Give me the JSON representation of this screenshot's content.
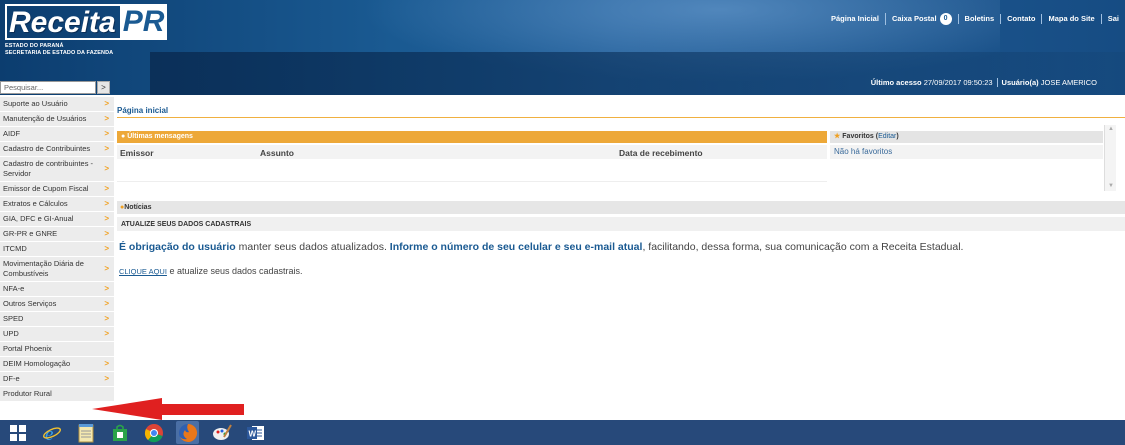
{
  "header": {
    "logo": {
      "main": "Receita",
      "accent": "PR",
      "line1": "ESTADO DO PARANÁ",
      "line2": "SECRETARIA DE ESTADO DA FAZENDA"
    },
    "topnav": {
      "home": "Página Inicial",
      "mailbox": "Caixa Postal",
      "mailbox_count": "0",
      "bulletins": "Boletins",
      "contact": "Contato",
      "sitemap": "Mapa do Site",
      "exit": "Sai"
    },
    "access": {
      "last_access_label": "Último acesso",
      "last_access_value": "27/09/2017 09:50:23",
      "user_label": "Usuário(a)",
      "user_value": "JOSE AMERICO"
    }
  },
  "sidebar": {
    "search_placeholder": "Pesquisar...",
    "search_button": ">",
    "items": [
      {
        "label": "Suporte ao Usuário",
        "arrow": ">"
      },
      {
        "label": "Manutenção de Usuários",
        "arrow": ">"
      },
      {
        "label": "AIDF",
        "arrow": ">"
      },
      {
        "label": "Cadastro de Contribuintes",
        "arrow": ">"
      },
      {
        "label": "Cadastro de contribuintes - Servidor",
        "arrow": ">"
      },
      {
        "label": "Emissor de Cupom Fiscal",
        "arrow": ">"
      },
      {
        "label": "Extratos e Cálculos",
        "arrow": ">"
      },
      {
        "label": "GIA, DFC e GI-Anual",
        "arrow": ">"
      },
      {
        "label": "GR-PR e GNRE",
        "arrow": ">"
      },
      {
        "label": "ITCMD",
        "arrow": ">"
      },
      {
        "label": "Movimentação Diária de Combustíveis",
        "arrow": ">"
      },
      {
        "label": "NFA-e",
        "arrow": ">"
      },
      {
        "label": "Outros Serviços",
        "arrow": ">"
      },
      {
        "label": "SPED",
        "arrow": ">"
      },
      {
        "label": "UPD",
        "arrow": ">"
      },
      {
        "label": "Portal Phoenix",
        "arrow": ""
      },
      {
        "label": "DEIM Homologação",
        "arrow": ">"
      },
      {
        "label": "DF-e",
        "arrow": ">"
      },
      {
        "label": "Produtor Rural",
        "arrow": ""
      }
    ]
  },
  "main": {
    "breadcrumb": "Página inicial",
    "messages": {
      "title": "Últimas mensagens",
      "col_sender": "Emissor",
      "col_subject": "Assunto",
      "col_received": "Data de recebimento"
    },
    "favorites": {
      "title": "Favoritos",
      "edit_label": "Editar",
      "empty": "Não há favoritos"
    },
    "news": {
      "title": "Notícias",
      "subtitle": "ATUALIZE SEUS DADOS CADASTRAIS",
      "line1_bold1": "É obrigação do usuário",
      "line1_text1": " manter seus dados atualizados. ",
      "line1_bold2": "Informe o número de seu celular e seu e-mail atual",
      "line1_text2": ", facilitando, dessa forma, sua comunicação com a Receita Estadual.",
      "line2_link": "CLIQUE AQUI",
      "line2_text": " e atualize seus dados cadastrais."
    }
  },
  "taskbar": {
    "icons": [
      "windows-start-icon",
      "internet-explorer-icon",
      "notepad-icon",
      "store-icon",
      "chrome-icon",
      "firefox-icon",
      "paint-icon",
      "word-icon"
    ]
  },
  "colors": {
    "header_blue": "#1a5a92",
    "accent_orange": "#eda838",
    "annotation_red": "#e02020",
    "taskbar": "#27497a"
  }
}
